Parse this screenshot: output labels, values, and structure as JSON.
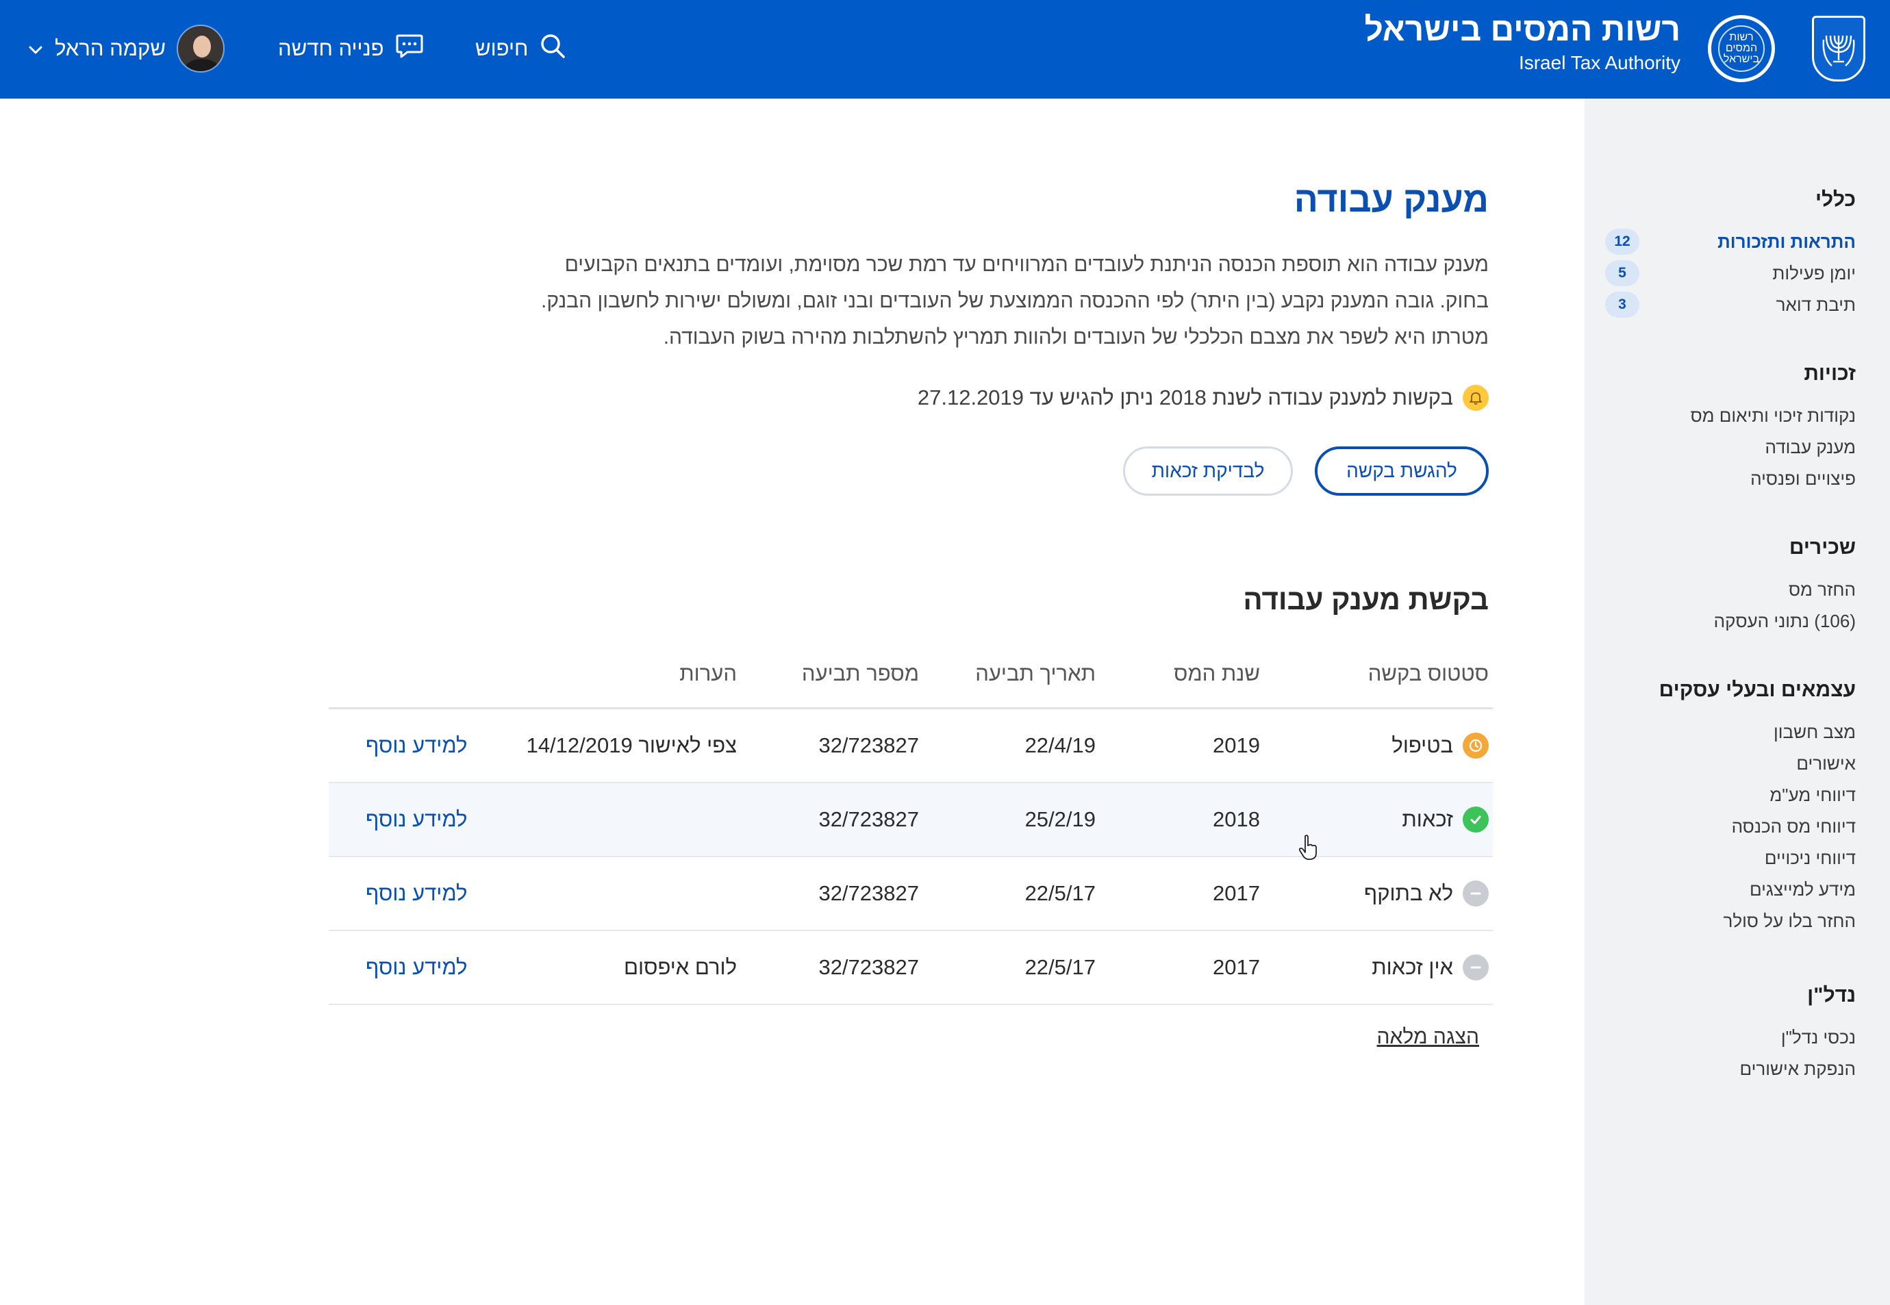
{
  "header": {
    "brand_he": "רשות המסים בישראל",
    "brand_en": "Israel Tax Authority",
    "logo_text": "רשות המסים בישראל",
    "search_label": "חיפוש",
    "new_inquiry_label": "פנייה חדשה",
    "user_name": "שקמה הראל",
    "brand_color": "#005bc9"
  },
  "sidebar": {
    "groups": [
      {
        "title": "כללי",
        "items": [
          {
            "label": "התראות ותזכורות",
            "count": "12"
          },
          {
            "label": "יומן פעילות",
            "count": "5"
          },
          {
            "label": "תיבת דואר",
            "count": "3"
          }
        ]
      },
      {
        "title": "זכויות",
        "items": [
          {
            "label": "נקודות זיכוי ותיאום מס"
          },
          {
            "label": "מענק עבודה"
          },
          {
            "label": "פיצויים ופנסיה"
          }
        ]
      },
      {
        "title": "שכירים",
        "items": [
          {
            "label": "החזר מס"
          },
          {
            "label": "(106) נתוני העסקה"
          }
        ]
      },
      {
        "title": "עצמאים ובעלי עסקים",
        "items": [
          {
            "label": "מצב חשבון"
          },
          {
            "label": "אישורים"
          },
          {
            "label": "דיווחי מע\"מ"
          },
          {
            "label": "דיווחי מס הכנסה"
          },
          {
            "label": "דיווחי ניכויים"
          },
          {
            "label": "מידע למייצגים"
          },
          {
            "label": "החזר בלו על סולר"
          }
        ]
      },
      {
        "title": "נדל\"ן",
        "items": [
          {
            "label": "נכסי נדל\"ן"
          },
          {
            "label": "הנפקת אישורים"
          }
        ]
      }
    ]
  },
  "main": {
    "title": "מענק עבודה",
    "intro_lines": [
      "מענק עבודה הוא תוספת הכנסה הניתנת לעובדים המרוויחים עד רמת שכר מסוימת, ועומדים בתנאים הקבועים",
      "בחוק. גובה המענק נקבע (בין היתר) לפי ההכנסה הממוצעת של העובדים ובני זוגם, ומשולם ישירות לחשבון הבנק.",
      "מטרתו היא לשפר את מצבם הכלכלי של העובדים ולהוות תמריץ להשתלבות מהירה בשוק העבודה."
    ],
    "notice": "בקשות למענק עבודה לשנת 2018 ניתן להגיש עד 27.12.2019",
    "submit_button": "להגשת בקשה",
    "eligibility_button": "לבדיקת זכאות",
    "section_title": "בקשת מענק עבודה",
    "table": {
      "headers": [
        "סטטוס בקשה",
        "שנת המס",
        "תאריך תביעה",
        "מספר תביעה",
        "הערות"
      ],
      "rows": [
        {
          "status": "בטיפול",
          "status_icon": "clock-icon",
          "status_color": "#f5a83a",
          "year": "2019",
          "date": "22/4/19",
          "number": "32/723827",
          "note": "צפי לאישור 14/12/2019",
          "link": "למידע נוסף"
        },
        {
          "status": "זכאות",
          "status_icon": "check-icon",
          "status_color": "#3cc45a",
          "year": "2018",
          "date": "25/2/19",
          "number": "32/723827",
          "note": "",
          "link": "למידע נוסף"
        },
        {
          "status": "לא בתוקף",
          "status_icon": "minus-icon",
          "status_color": "#c9cdd2",
          "year": "2017",
          "date": "22/5/17",
          "number": "32/723827",
          "note": "",
          "link": "למידע נוסף"
        },
        {
          "status": "אין זכאות",
          "status_icon": "minus-icon",
          "status_color": "#c9cdd2",
          "year": "2017",
          "date": "22/5/17",
          "number": "32/723827",
          "note": "לורם איפסום",
          "link": "למידע נוסף"
        }
      ]
    },
    "full_view_link": "הצגה מלאה"
  }
}
